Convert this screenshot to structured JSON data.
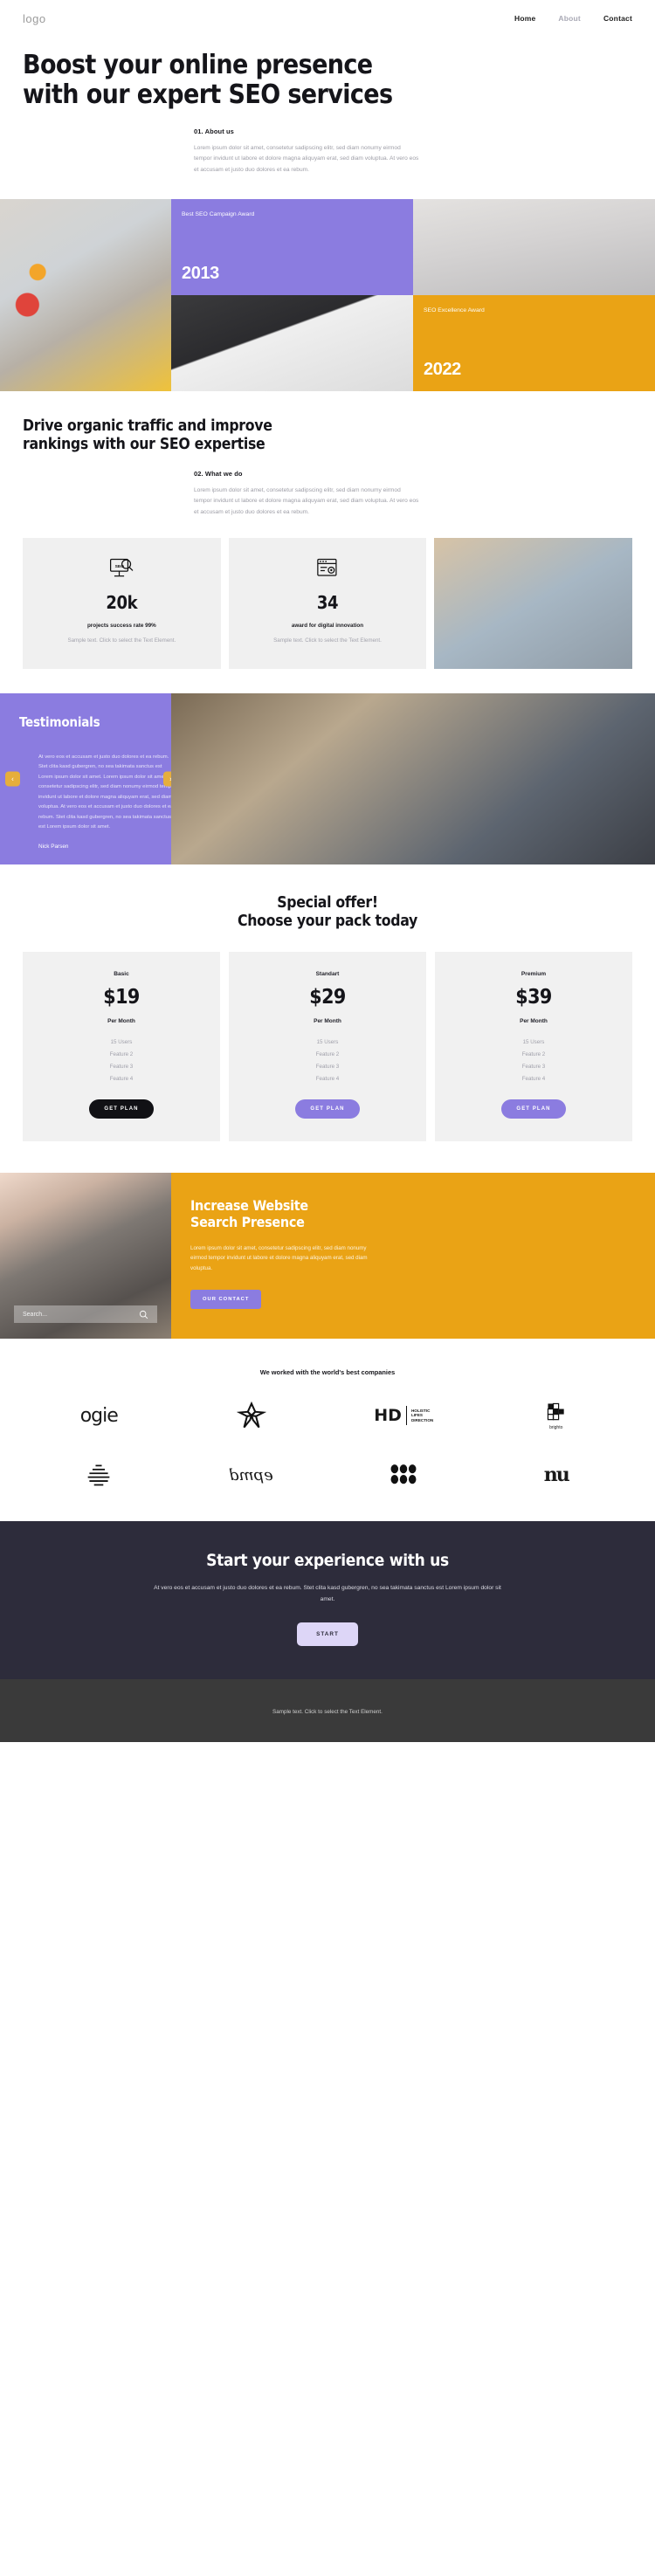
{
  "header": {
    "logo": "logo",
    "nav": [
      {
        "label": "Home",
        "active": true
      },
      {
        "label": "About",
        "active": false
      },
      {
        "label": "Contact",
        "active": false
      }
    ]
  },
  "hero": {
    "title": "Boost your online presence with our expert SEO services",
    "kicker": "01. About us",
    "paragraph": "Lorem ipsum dolor sit amet, consetetur sadipscing elitr, sed diam nonumy eirmod tempor invidunt ut labore et dolore magna aliquyam erat, sed diam voluptua. At vero eos et accusam et justo duo dolores et ea rebum."
  },
  "awards": {
    "purple": {
      "title": "Best SEO Campaign Award",
      "year": "2013",
      "color": "#8b7ce0"
    },
    "orange": {
      "title": "SEO Excellence Award",
      "year": "2022",
      "color": "#eaa315"
    },
    "images": {
      "desk": "seo-analytics-desk-photo",
      "model": "fashion-model-photo",
      "tablet": "tablet-analytics-photo"
    }
  },
  "services": {
    "title": "Drive organic traffic and improve rankings with our SEO expertise",
    "kicker": "02. What we do",
    "paragraph": "Lorem ipsum dolor sit amet, consetetur sadipscing elitr, sed diam nonumy eirmod tempor invidunt ut labore et dolore magna aliquyam erat, sed diam voluptua. At vero eos et accusam et justo duo dolores et ea rebum.",
    "stats": [
      {
        "icon": "seo-monitor-icon",
        "value": "20k",
        "label": "projects success rate 99%",
        "note": "Sample text. Click to select the Text Element."
      },
      {
        "icon": "browser-gear-icon",
        "value": "34",
        "label": "award for digital innovation",
        "note": "Sample text. Click to select the Text Element."
      }
    ],
    "photo": "team-working-photo"
  },
  "testimonials": {
    "heading": "Testimonials",
    "quote": "At vero eos et accusam et justo duo dolores et ea rebum. Stet clita kasd gubergren, no sea takimata sanctus est Lorem ipsum dolor sit amet. Lorem ipsum dolor sit amet, consetetur sadipscing elitr, sed diam nonumy eirmod tempor invidunt ut labore et dolore magna aliquyam erat, sed diam voluptua. At vero eos et accusam et justo duo dolores et ea rebum. Stet clita kasd gubergren, no sea takimata sanctus est Lorem ipsum dolor sit amet.",
    "author": "Nick Parsen",
    "prev_icon": "chevron-left-icon",
    "next_icon": "chevron-right-icon",
    "photo": "man-at-desk-photo",
    "accent": "#8b7ce0",
    "arrow_color": "#e6ae3c"
  },
  "pricing": {
    "title": "Special offer! Choose your pack today",
    "title_line1": "Special offer!",
    "title_line2": "Choose your pack today",
    "plans": [
      {
        "name": "Basic",
        "price": "$19",
        "period": "Per Month",
        "features": [
          "15 Users",
          "Feature 2",
          "Feature 3",
          "Feature 4"
        ],
        "cta": "GET PLAN",
        "cta_style": "dark"
      },
      {
        "name": "Standart",
        "price": "$29",
        "period": "Per Month",
        "features": [
          "15 Users",
          "Feature 2",
          "Feature 3",
          "Feature 4"
        ],
        "cta": "GET PLAN",
        "cta_style": "violet"
      },
      {
        "name": "Premium",
        "price": "$39",
        "period": "Per Month",
        "features": [
          "15 Users",
          "Feature 2",
          "Feature 3",
          "Feature 4"
        ],
        "cta": "GET PLAN",
        "cta_style": "violet"
      }
    ]
  },
  "presence": {
    "title_line1": "Increase Website",
    "title_line2": "Search Presence",
    "paragraph": "Lorem ipsum dolor sit amet, consetetur sadipscing elitr, sed diam nonumy eirmod tempor invidunt ut labore et dolore magna aliquyam erat, sed diam voluptua.",
    "button": "OUR CONTACT",
    "search_placeholder": "Search...",
    "search_value": "",
    "search_icon": "search-icon",
    "photo": "typing-keyboard-photo",
    "bg": "#eaa315"
  },
  "partners": {
    "title": "We worked with the world's best companies",
    "logos": [
      {
        "name": "ogie-logo",
        "text": "ogie"
      },
      {
        "name": "flower-logo",
        "text": ""
      },
      {
        "name": "hd-holistic-lifes-direction-logo",
        "text": "HD",
        "sub1": "HOLISTIC",
        "sub2": "LIFES",
        "sub3": "DIRECTION"
      },
      {
        "name": "brighto-logo",
        "text": "brighto"
      },
      {
        "name": "stacked-lines-logo",
        "text": ""
      },
      {
        "name": "epmd-logo",
        "text": "epmd"
      },
      {
        "name": "dots-logo",
        "text": ""
      },
      {
        "name": "nu-logo",
        "text": "nu"
      }
    ]
  },
  "cta": {
    "title": "Start your experience with us",
    "paragraph": "At vero eos et accusam et justo duo dolores et ea rebum. Stet clita kasd gubergren, no sea takimata sanctus est Lorem ipsum dolor sit amet.",
    "button": "START",
    "bg": "#2d2c3b",
    "button_color": "#ddd6f7"
  },
  "footer": {
    "text": "Sample text. Click to select the Text Element.",
    "bg": "#3a3a3a"
  }
}
